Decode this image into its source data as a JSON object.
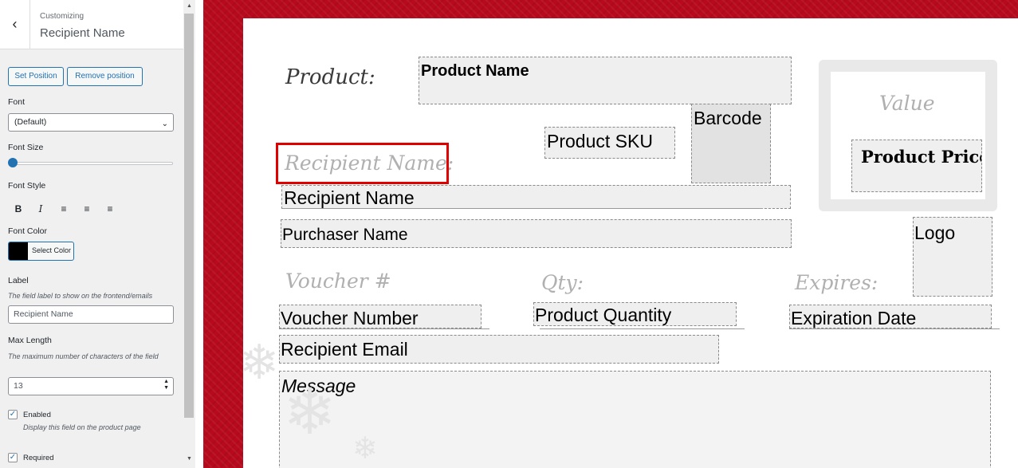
{
  "sidebar": {
    "header": {
      "crumb": "Customizing",
      "title": "Recipient Name"
    },
    "set_position": "Set Position",
    "remove_position": "Remove position",
    "font": {
      "label": "Font",
      "value": "(Default)"
    },
    "font_size": {
      "label": "Font Size",
      "value": 0
    },
    "font_style": {
      "label": "Font Style"
    },
    "font_color": {
      "label": "Font Color",
      "button": "Select Color",
      "color": "#000000"
    },
    "field_label": {
      "label": "Label",
      "desc": "The field label to show on the frontend/emails",
      "value": "Recipient Name"
    },
    "max_length": {
      "label": "Max Length",
      "desc": "The maximum number of characters of the field",
      "value": "13"
    },
    "enabled": {
      "label": "Enabled",
      "desc": "Display this field on the product page",
      "checked": true
    },
    "required": {
      "label": "Required",
      "checked": true
    }
  },
  "preview": {
    "labels": {
      "product": "Product:",
      "recipient": "Recipient Name:",
      "value": "Value",
      "voucher": "Voucher #",
      "qty": "Qty:",
      "expires": "Expires:"
    },
    "fields": {
      "product_name": "Product Name",
      "barcode": "Barcode",
      "product_sku": "Product SKU",
      "product_price": "Product Price",
      "recipient_name": "Recipient Name",
      "purchaser_name": "Purchaser Name",
      "logo": "Logo",
      "voucher_number": "Voucher Number",
      "product_quantity": "Product Quantity",
      "expiration_date": "Expiration Date",
      "recipient_email": "Recipient Email",
      "message": "Message"
    },
    "colors": {
      "background": "#b80a1e",
      "highlight": "#e00000",
      "script": "#b0b0b0"
    }
  }
}
